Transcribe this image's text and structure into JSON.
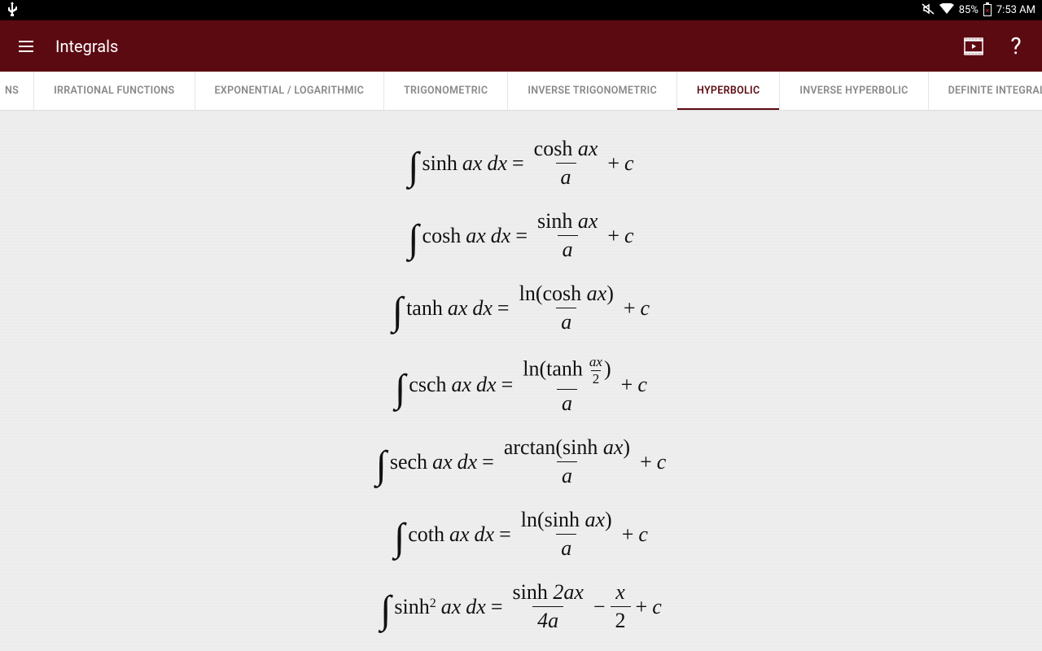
{
  "statusbar": {
    "battery_pct": "85%",
    "time": "7:53 AM"
  },
  "appbar": {
    "title": "Integrals"
  },
  "tabs": [
    {
      "id": "ns",
      "label": "NS",
      "active": false,
      "partial": true
    },
    {
      "id": "irrational",
      "label": "IRRATIONAL FUNCTIONS",
      "active": false
    },
    {
      "id": "explog",
      "label": "EXPONENTIAL / LOGARITHMIC",
      "active": false
    },
    {
      "id": "trig",
      "label": "TRIGONOMETRIC",
      "active": false
    },
    {
      "id": "invtrig",
      "label": "INVERSE TRIGONOMETRIC",
      "active": false
    },
    {
      "id": "hyperbolic",
      "label": "HYPERBOLIC",
      "active": true
    },
    {
      "id": "invhyp",
      "label": "INVERSE HYPERBOLIC",
      "active": false
    },
    {
      "id": "definite",
      "label": "DEFINITE INTEGRALS",
      "active": false
    }
  ],
  "formulas": [
    {
      "id": "sinh",
      "lhs_fn": "sinh",
      "lhs_exp": "",
      "rhs_type": "frac_plus_c",
      "num": "cosh ax",
      "den": "a"
    },
    {
      "id": "cosh",
      "lhs_fn": "cosh",
      "lhs_exp": "",
      "rhs_type": "frac_plus_c",
      "num": "sinh ax",
      "den": "a"
    },
    {
      "id": "tanh",
      "lhs_fn": "tanh",
      "lhs_exp": "",
      "rhs_type": "frac_plus_c",
      "num": "ln(cosh ax)",
      "den": "a"
    },
    {
      "id": "csch",
      "lhs_fn": "csch",
      "lhs_exp": "",
      "rhs_type": "csch_special",
      "num_prefix": "ln",
      "num_inner_fn": "tanh",
      "num_frac_n": "ax",
      "num_frac_d": "2",
      "den": "a"
    },
    {
      "id": "sech",
      "lhs_fn": "sech",
      "lhs_exp": "",
      "rhs_type": "frac_plus_c",
      "num": "arctan(sinh ax)",
      "den": "a"
    },
    {
      "id": "coth",
      "lhs_fn": "coth",
      "lhs_exp": "",
      "rhs_type": "frac_plus_c",
      "num": "ln(sinh ax)",
      "den": "a"
    },
    {
      "id": "sinh2",
      "lhs_fn": "sinh",
      "lhs_exp": "2",
      "rhs_type": "two_fracs",
      "num1": "sinh 2ax",
      "den1": "4a",
      "op": "−",
      "num2": "x",
      "den2": "2"
    }
  ],
  "glyphs": {
    "integral": "∫",
    "equals": "=",
    "plus": "+",
    "c": "c",
    "dx": "dx",
    "ax": "ax",
    "lparen": "(",
    "rparen": ")"
  }
}
